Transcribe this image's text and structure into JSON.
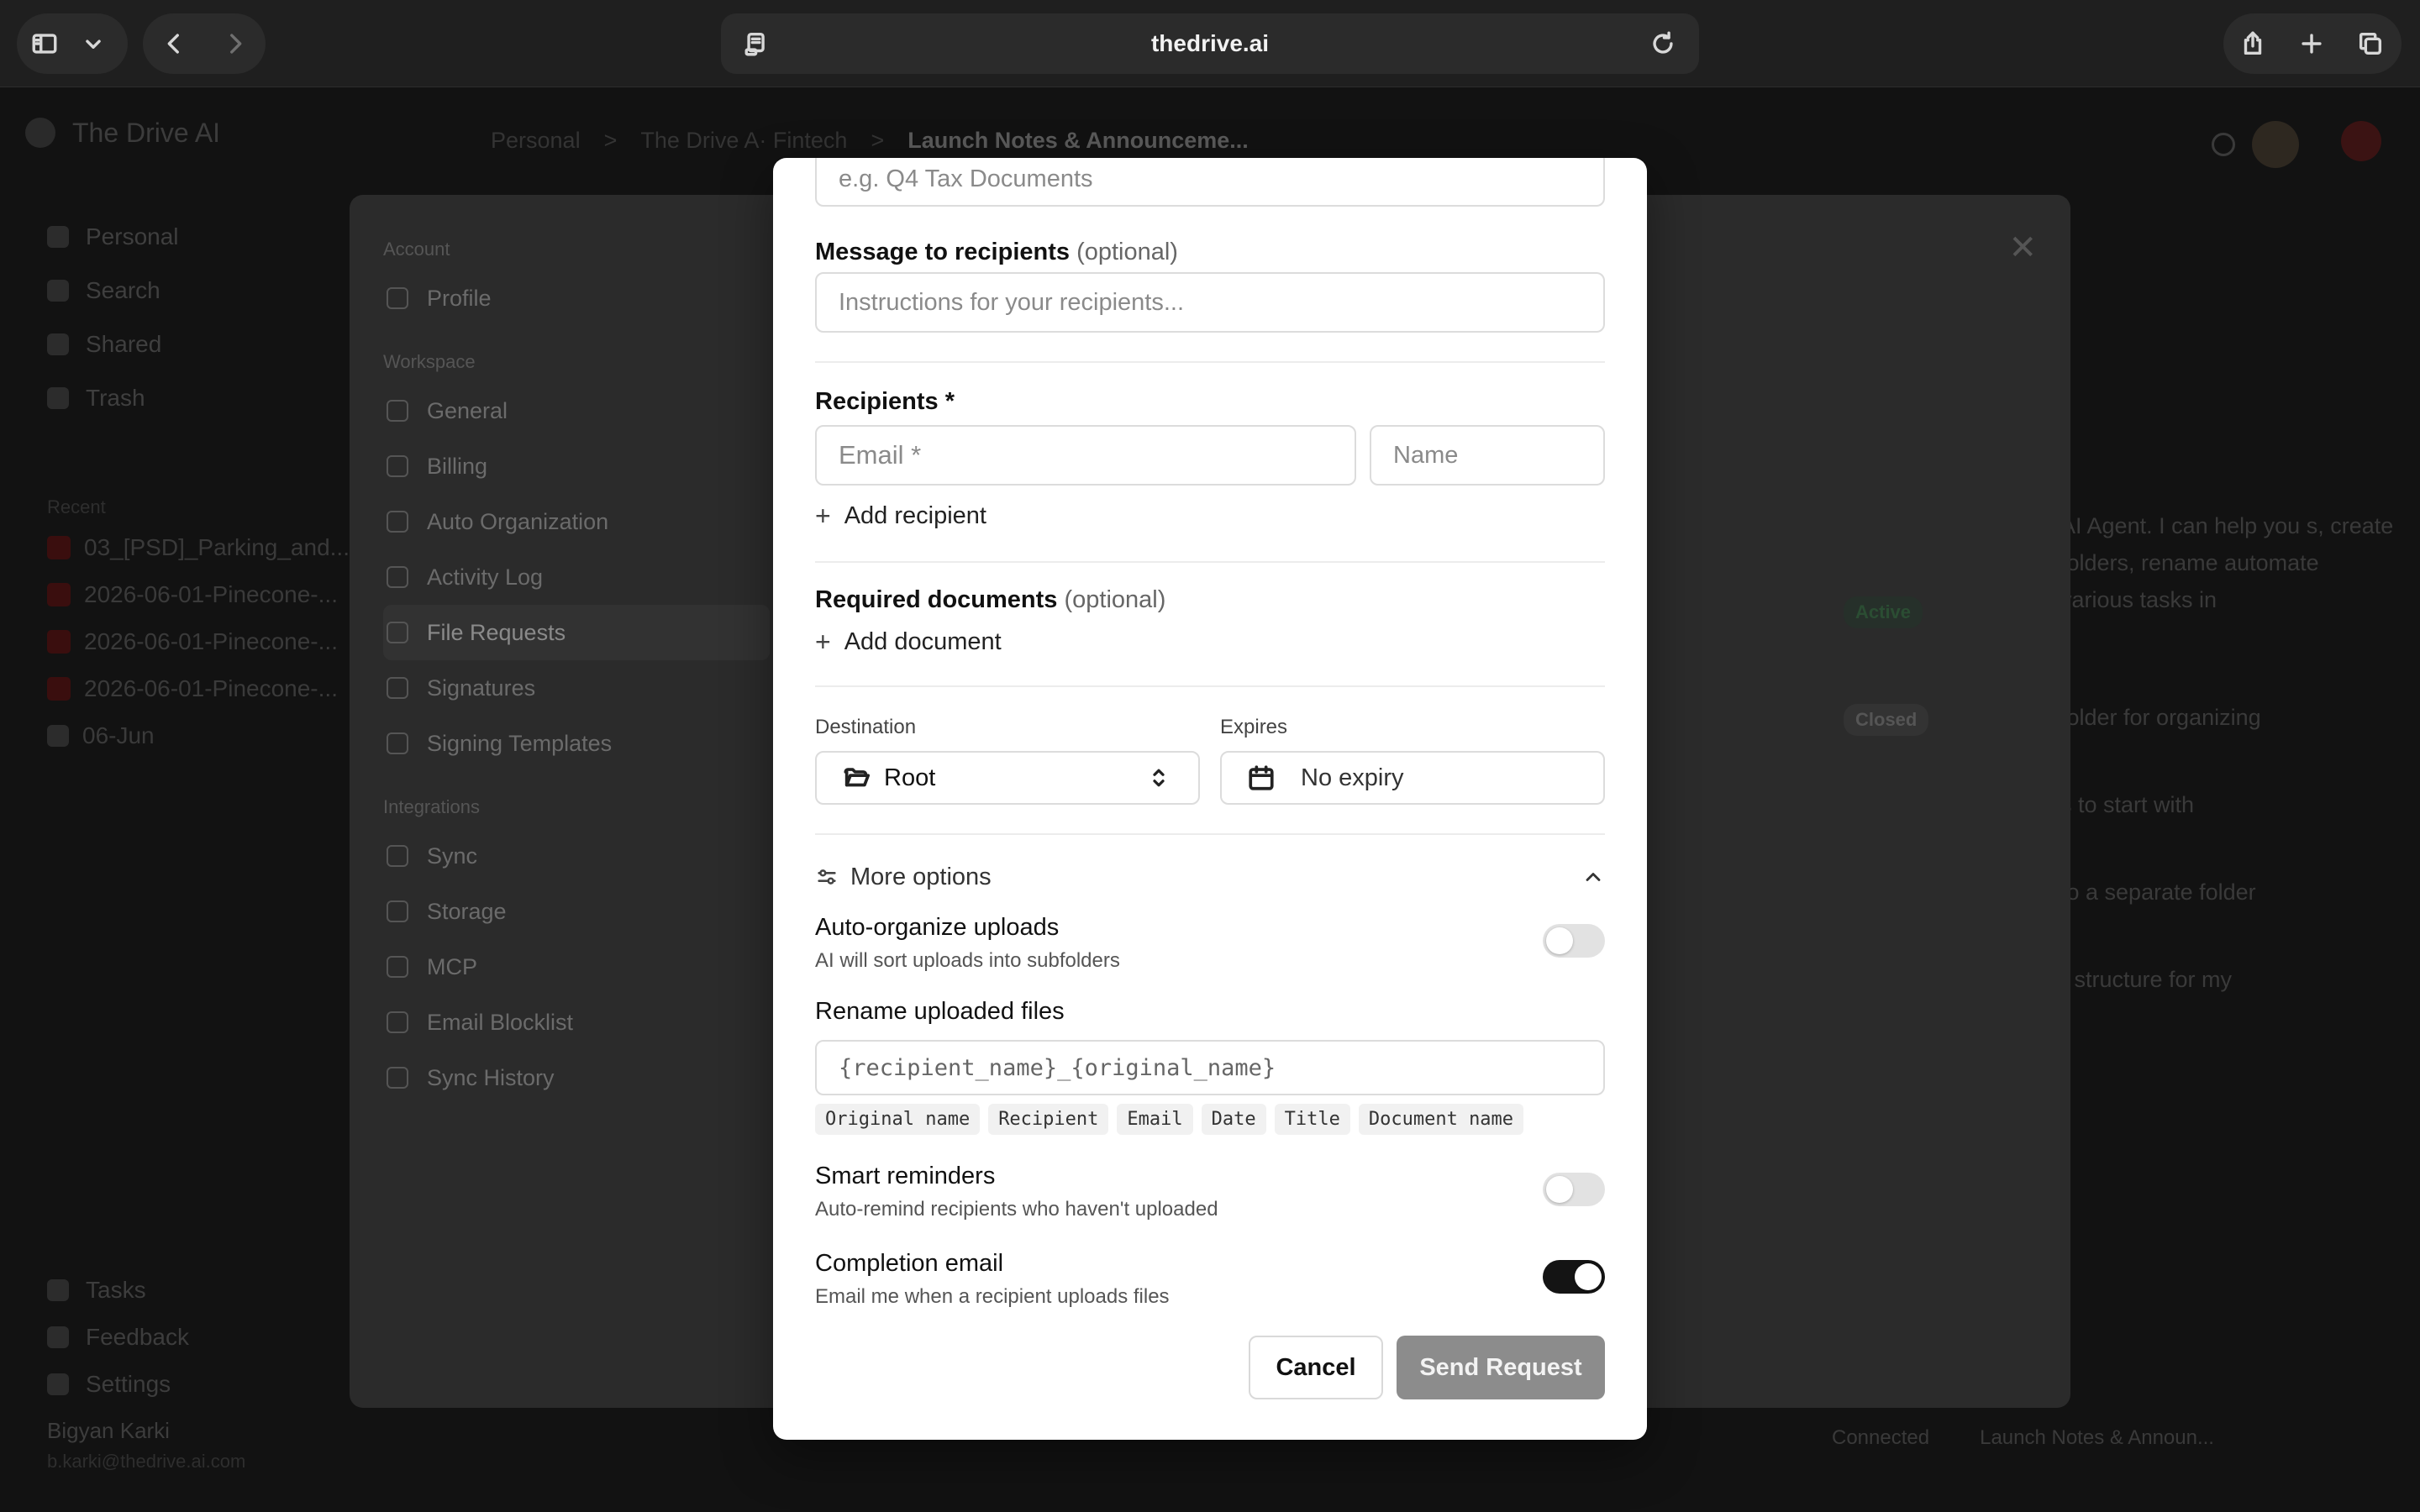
{
  "browser": {
    "url": "thedrive.ai"
  },
  "app_background": {
    "brand": "The Drive AI",
    "breadcrumb": [
      "Personal",
      ">",
      "The Drive A· Fintech",
      ">",
      "Launch Notes & Announceme..."
    ],
    "left_nav": [
      "Personal",
      "Search",
      "Shared",
      "Trash"
    ],
    "recent_label": "Recent",
    "recent_items": [
      "03_[PSD]_Parking_and...",
      "2026-06-01-Pinecone-...",
      "2026-06-01-Pinecone-...",
      "2026-06-01-Pinecone-...",
      "06-Jun"
    ],
    "bottom_nav": [
      "Tasks",
      "Feedback",
      "Settings"
    ],
    "user_name": "Bigyan Karki",
    "user_email": "b.karki@thedrive.ai.com",
    "status_connected": "Connected",
    "status_doc": "Launch Notes & Announ...",
    "chat_lines": [
      "AI Agent. I can help you s, create folders, rename automate various tasks in",
      "folder for organizing",
      "s to start with",
      "to a separate folder",
      "r structure for my"
    ]
  },
  "settings": {
    "sections": [
      {
        "title": "Account",
        "items": [
          "Profile"
        ]
      },
      {
        "title": "Workspace",
        "items": [
          "General",
          "Billing",
          "Auto Organization",
          "Activity Log",
          "File Requests",
          "Signatures",
          "Signing Templates"
        ]
      },
      {
        "title": "Integrations",
        "items": [
          "Sync",
          "Storage",
          "MCP",
          "Email Blocklist",
          "Sync History"
        ]
      }
    ],
    "active_item": "File Requests",
    "badge_active": "Active",
    "badge_closed": "Closed"
  },
  "modal": {
    "title_placeholder": "e.g. Q4 Tax Documents",
    "message_label": "Message to recipients",
    "message_optional": "(optional)",
    "message_placeholder": "Instructions for your recipients...",
    "recipients_label": "Recipients *",
    "email_placeholder": "Email *",
    "name_placeholder": "Name",
    "add_recipient": "Add recipient",
    "required_docs_label": "Required documents",
    "required_docs_optional": "(optional)",
    "add_document": "Add document",
    "destination_label": "Destination",
    "destination_value": "Root",
    "expires_label": "Expires",
    "expires_value": "No expiry",
    "more_options": "More options",
    "auto_organize_title": "Auto-organize uploads",
    "auto_organize_sub": "AI will sort uploads into subfolders",
    "auto_organize_on": false,
    "rename_label": "Rename uploaded files",
    "rename_placeholder": "{recipient_name}_{original_name}",
    "rename_tokens": [
      "Original name",
      "Recipient",
      "Email",
      "Date",
      "Title",
      "Document name"
    ],
    "smart_reminders_title": "Smart reminders",
    "smart_reminders_sub": "Auto-remind recipients who haven't uploaded",
    "smart_reminders_on": false,
    "completion_email_title": "Completion email",
    "completion_email_sub": "Email me when a recipient uploads files",
    "completion_email_on": true,
    "cancel_label": "Cancel",
    "send_label": "Send Request"
  },
  "colors": {
    "toggle_on": "#141414",
    "toggle_off": "#e2e2e2",
    "send_disabled": "#8c8c8c"
  }
}
